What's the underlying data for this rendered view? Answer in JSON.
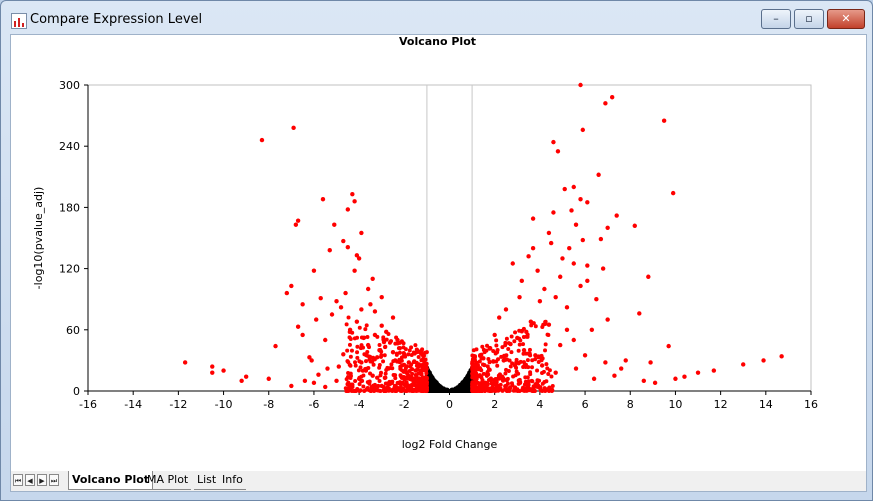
{
  "window": {
    "title": "Compare Expression Level",
    "min_label": "–",
    "max_label": "▫",
    "close_label": "✕"
  },
  "tabs": {
    "items": [
      {
        "label": "Volcano Plot"
      },
      {
        "label": "MA Plot"
      },
      {
        "label": "List"
      },
      {
        "label": "Info"
      }
    ],
    "active": "Volcano Plot"
  },
  "nav": {
    "first": "⏮",
    "prev": "◀",
    "next": "▶",
    "last": "⏭"
  },
  "colors": {
    "significant": "#ff0000",
    "nonsignificant": "#000000",
    "threshold_line": "#c8c8c8"
  },
  "chart_data": {
    "type": "scatter",
    "title": "Volcano Plot",
    "xlabel": "log2 Fold Change",
    "ylabel": "-log10(pvalue_adj)",
    "xlim": [
      -16,
      16
    ],
    "ylim": [
      0,
      300
    ],
    "xticks": [
      -16,
      -14,
      -12,
      -10,
      -8,
      -6,
      -4,
      -2,
      0,
      2,
      4,
      6,
      8,
      10,
      12,
      14,
      16
    ],
    "yticks": [
      0,
      60,
      120,
      180,
      240,
      300
    ],
    "thresholds_x": [
      -1,
      1
    ],
    "grid": false,
    "series": [
      {
        "color": "red",
        "points": [
          [
            -8.3,
            246
          ],
          [
            -6.9,
            258
          ],
          [
            -5.6,
            188
          ],
          [
            -4.3,
            193
          ],
          [
            -4.2,
            186
          ],
          [
            -4.5,
            178
          ],
          [
            -6.7,
            167
          ],
          [
            -6.8,
            163
          ],
          [
            -3.9,
            155
          ],
          [
            -4.1,
            133
          ],
          [
            -5.1,
            163
          ],
          [
            -4.7,
            147
          ],
          [
            -4.5,
            141
          ],
          [
            -4.0,
            130
          ],
          [
            -6.0,
            118
          ],
          [
            -5.3,
            138
          ],
          [
            -7.0,
            103
          ],
          [
            -7.2,
            96
          ],
          [
            -6.5,
            85
          ],
          [
            -5.7,
            91
          ],
          [
            -5.0,
            88
          ],
          [
            -4.8,
            82
          ],
          [
            -3.5,
            85
          ],
          [
            -3.3,
            78
          ],
          [
            -3.0,
            64
          ],
          [
            -2.8,
            58
          ],
          [
            -2.5,
            72
          ],
          [
            -6.7,
            63
          ],
          [
            -6.5,
            55
          ],
          [
            -5.9,
            70
          ],
          [
            -5.5,
            50
          ],
          [
            -3.8,
            52
          ],
          [
            -4.4,
            60
          ],
          [
            -6.2,
            33
          ],
          [
            -7.7,
            44
          ],
          [
            -6.1,
            30
          ],
          [
            -5.4,
            22
          ],
          [
            -4.7,
            36
          ],
          [
            -3.9,
            28
          ],
          [
            -3.1,
            40
          ],
          [
            -3.6,
            45
          ],
          [
            -2.2,
            42
          ],
          [
            -2.0,
            35
          ],
          [
            -1.8,
            28
          ],
          [
            -1.5,
            20
          ],
          [
            -1.2,
            10
          ],
          [
            -1.6,
            12
          ],
          [
            -2.4,
            30
          ],
          [
            -2.7,
            22
          ],
          [
            -3.4,
            15
          ],
          [
            -4.0,
            12
          ],
          [
            -5.0,
            10
          ],
          [
            -6.0,
            8
          ],
          [
            -7.0,
            5
          ],
          [
            -8.0,
            12
          ],
          [
            -9.0,
            14
          ],
          [
            -10.5,
            18
          ],
          [
            -10.5,
            24
          ],
          [
            -11.7,
            28
          ],
          [
            -10.0,
            20
          ],
          [
            -9.2,
            10
          ],
          [
            -2.3,
            50
          ],
          [
            -2.9,
            48
          ],
          [
            -3.2,
            33
          ],
          [
            -1.9,
            18
          ],
          [
            -1.4,
            6
          ],
          [
            -2.6,
            8
          ],
          [
            -3.0,
            5
          ],
          [
            -4.3,
            4
          ],
          [
            -5.5,
            4
          ],
          [
            -6.4,
            10
          ],
          [
            -4.9,
            24
          ],
          [
            -5.8,
            16
          ],
          [
            -3.7,
            20
          ],
          [
            -2.1,
            25
          ],
          [
            -1.7,
            14
          ],
          [
            -2.5,
            38
          ],
          [
            -3.3,
            55
          ],
          [
            -4.1,
            68
          ],
          [
            -3.9,
            80
          ],
          [
            -3.0,
            92
          ],
          [
            -3.6,
            100
          ],
          [
            -3.4,
            110
          ],
          [
            -4.2,
            118
          ],
          [
            -4.6,
            96
          ],
          [
            -5.2,
            75
          ],
          [
            5.8,
            300
          ],
          [
            7.2,
            288
          ],
          [
            6.9,
            282
          ],
          [
            9.5,
            265
          ],
          [
            5.9,
            256
          ],
          [
            4.6,
            244
          ],
          [
            4.8,
            235
          ],
          [
            5.1,
            198
          ],
          [
            5.5,
            200
          ],
          [
            6.6,
            212
          ],
          [
            9.9,
            194
          ],
          [
            5.8,
            188
          ],
          [
            5.4,
            177
          ],
          [
            6.1,
            185
          ],
          [
            7.4,
            172
          ],
          [
            4.6,
            175
          ],
          [
            3.7,
            169
          ],
          [
            7.0,
            160
          ],
          [
            8.2,
            162
          ],
          [
            5.6,
            163
          ],
          [
            4.4,
            155
          ],
          [
            6.7,
            149
          ],
          [
            3.7,
            140
          ],
          [
            4.5,
            145
          ],
          [
            5.3,
            140
          ],
          [
            5.0,
            130
          ],
          [
            5.5,
            125
          ],
          [
            6.1,
            123
          ],
          [
            4.9,
            112
          ],
          [
            3.5,
            132
          ],
          [
            2.8,
            125
          ],
          [
            8.8,
            112
          ],
          [
            3.2,
            108
          ],
          [
            4.2,
            100
          ],
          [
            5.8,
            103
          ],
          [
            6.5,
            90
          ],
          [
            4.0,
            88
          ],
          [
            3.1,
            92
          ],
          [
            2.5,
            80
          ],
          [
            2.2,
            72
          ],
          [
            3.6,
            68
          ],
          [
            4.4,
            65
          ],
          [
            5.2,
            60
          ],
          [
            6.3,
            60
          ],
          [
            7.0,
            70
          ],
          [
            8.4,
            76
          ],
          [
            9.7,
            44
          ],
          [
            2.0,
            55
          ],
          [
            1.8,
            42
          ],
          [
            1.5,
            32
          ],
          [
            1.3,
            22
          ],
          [
            1.2,
            12
          ],
          [
            1.6,
            8
          ],
          [
            2.4,
            30
          ],
          [
            2.9,
            25
          ],
          [
            3.3,
            40
          ],
          [
            3.8,
            35
          ],
          [
            4.1,
            25
          ],
          [
            4.7,
            18
          ],
          [
            5.6,
            22
          ],
          [
            6.4,
            12
          ],
          [
            7.3,
            15
          ],
          [
            7.8,
            30
          ],
          [
            8.6,
            10
          ],
          [
            9.1,
            8
          ],
          [
            10.0,
            12
          ],
          [
            10.4,
            14
          ],
          [
            11.0,
            18
          ],
          [
            11.7,
            20
          ],
          [
            13.0,
            26
          ],
          [
            13.9,
            30
          ],
          [
            14.7,
            34
          ],
          [
            2.1,
            38
          ],
          [
            2.7,
            46
          ],
          [
            3.0,
            52
          ],
          [
            3.4,
            58
          ],
          [
            4.9,
            45
          ],
          [
            5.5,
            50
          ],
          [
            6.0,
            35
          ],
          [
            6.9,
            28
          ],
          [
            7.6,
            22
          ],
          [
            8.9,
            28
          ],
          [
            5.2,
            82
          ],
          [
            4.7,
            92
          ],
          [
            6.8,
            120
          ],
          [
            6.1,
            108
          ],
          [
            3.9,
            118
          ],
          [
            5.9,
            148
          ]
        ]
      },
      {
        "color": "black",
        "description_y_max": 25
      }
    ]
  }
}
